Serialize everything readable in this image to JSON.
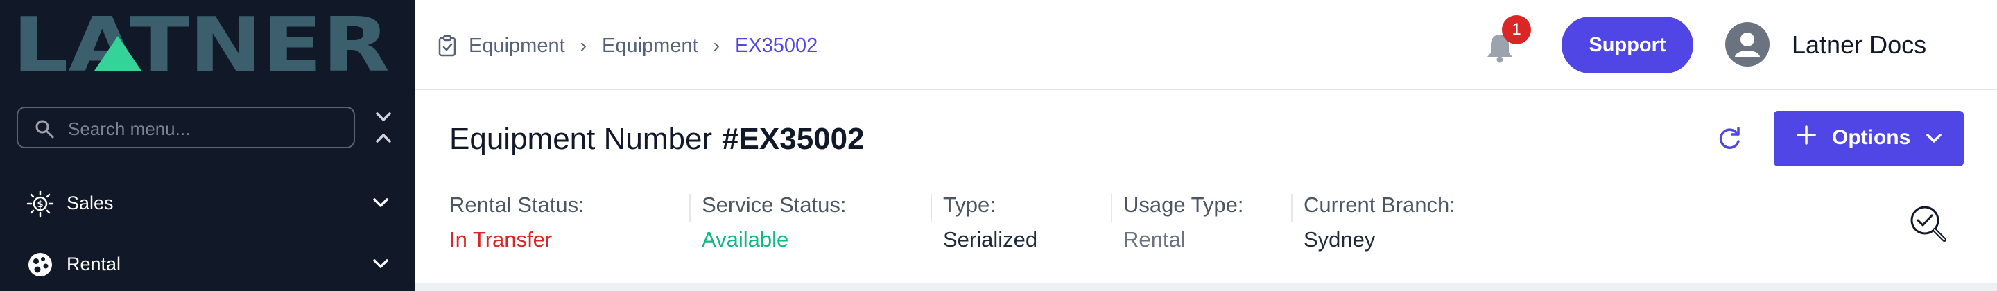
{
  "colors": {
    "sidebar_bg": "#111827",
    "accent": "#4f46e5",
    "logo_teal": "#3b5f6d",
    "logo_green": "#34d399",
    "status_red": "#dc2626",
    "status_green": "#10b981"
  },
  "sidebar": {
    "logo_text": "LATNER",
    "search": {
      "placeholder": "Search menu...",
      "icon": "search-icon"
    },
    "collapse_icon": "chevrons-collapse-icon",
    "items": [
      {
        "label": "Sales",
        "icon": "sales-icon"
      },
      {
        "label": "Rental",
        "icon": "rental-icon"
      }
    ]
  },
  "header": {
    "breadcrumbs": [
      "Equipment",
      "Equipment",
      "EX35002"
    ],
    "breadcrumb_icon": "clipboard-check-icon",
    "notifications": {
      "count": "1",
      "icon": "bell-icon"
    },
    "support_label": "Support",
    "user_name": "Latner Docs"
  },
  "detail": {
    "title_label": "Equipment Number",
    "equipment_number": "#EX35002",
    "refresh_icon": "refresh-icon",
    "options_label": "Options",
    "fields": [
      {
        "label": "Rental Status:",
        "value": "In Transfer"
      },
      {
        "label": "Service Status:",
        "value": "Available"
      },
      {
        "label": "Type:",
        "value": "Serialized"
      },
      {
        "label": "Usage Type:",
        "value": "Rental"
      },
      {
        "label": "Current Branch:",
        "value": "Sydney"
      }
    ],
    "inspect_icon": "inspect-check-icon"
  }
}
